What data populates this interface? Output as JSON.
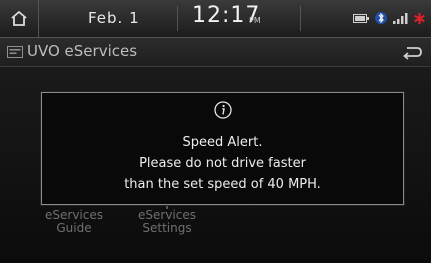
{
  "status_bar": {
    "date": "Feb.  1",
    "time": "12:17",
    "ampm": "PM",
    "icons": [
      "battery-icon",
      "bluetooth-phone-icon",
      "signal-strength-icon",
      "alert-asterisk-icon"
    ]
  },
  "title_bar": {
    "title": "UVO eServices"
  },
  "menu": {
    "items": [
      {
        "line1": "eServices",
        "line2": "Guide"
      },
      {
        "line1": "eServices",
        "line2": "Settings"
      }
    ]
  },
  "popup": {
    "icon": "info-icon",
    "heading": "Speed Alert.",
    "line1": "Please do not drive faster",
    "line2": "than the set speed of 40 MPH."
  },
  "colors": {
    "accent_red": "#e0202a",
    "text": "#ededed",
    "dim_text": "#6f6f6f"
  }
}
